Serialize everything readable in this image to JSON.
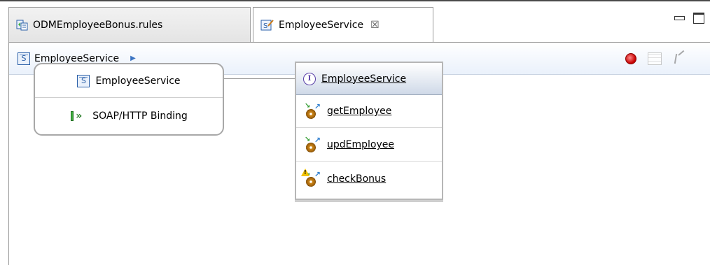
{
  "tabs": [
    {
      "label": "ODMEmployeeBonus.rules",
      "icon": "rules-file-icon",
      "active": false
    },
    {
      "label": "EmployeeService",
      "icon": "service-editor-icon",
      "active": true,
      "close_glyph": "☒"
    }
  ],
  "breadcrumb": {
    "icon": "service-s-icon",
    "label": "EmployeeService",
    "arrow": "▶"
  },
  "toolbar_icons": [
    "record-icon",
    "table-icon",
    "connect-icon"
  ],
  "export": {
    "name": "EmployeeService",
    "binding": "SOAP/HTTP Binding",
    "service_glyph": "S"
  },
  "interface": {
    "name": "EmployeeService",
    "glyph": "I",
    "operations": [
      {
        "name": "getEmployee",
        "warning": false
      },
      {
        "name": "updEmployee",
        "warning": false
      },
      {
        "name": "checkBonus",
        "warning": true
      }
    ]
  },
  "colors": {
    "accent": "#2a5fa8",
    "interface_glyph": "#5a3fa8",
    "binding_green": "#3fb03f",
    "warning": "#f2c200"
  }
}
